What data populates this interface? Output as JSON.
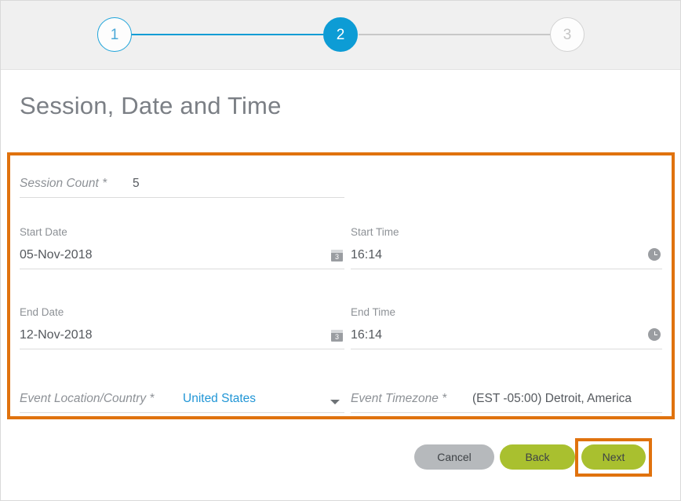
{
  "stepper": {
    "steps": [
      {
        "number": "1",
        "state": "completed"
      },
      {
        "number": "2",
        "state": "active"
      },
      {
        "number": "3",
        "state": "upcoming"
      }
    ],
    "accent_color": "#0d9cd5",
    "inactive_color": "#c8c8c8"
  },
  "header": {
    "title": "Session, Date and Time"
  },
  "form": {
    "highlight_color": "#e0720e",
    "session_count": {
      "label": "Session Count *",
      "value": "5"
    },
    "start_date": {
      "label": "Start Date",
      "value": "05-Nov-2018",
      "icon_day": "3"
    },
    "start_time": {
      "label": "Start Time",
      "value": "16:14"
    },
    "end_date": {
      "label": "End Date",
      "value": "12-Nov-2018",
      "icon_day": "3"
    },
    "end_time": {
      "label": "End Time",
      "value": "16:14"
    },
    "event_location": {
      "label": "Event Location/Country *",
      "value": "United States",
      "value_color": "#2196d6"
    },
    "event_timezone": {
      "label": "Event Timezone *",
      "value": "(EST -05:00) Detroit, America"
    }
  },
  "footer": {
    "cancel_label": "Cancel",
    "back_label": "Back",
    "next_label": "Next",
    "primary_color": "#a9c02f",
    "cancel_color": "#b6b9bc",
    "highlight_color": "#e0720e"
  }
}
